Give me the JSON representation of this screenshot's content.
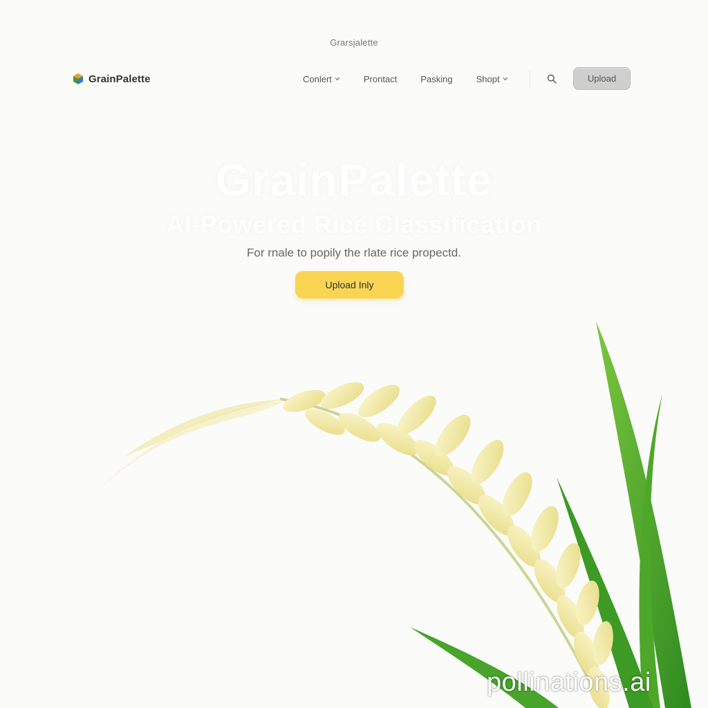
{
  "page": {
    "tagline": "Grarsįalette"
  },
  "header": {
    "brand": {
      "name": "GrainPalette",
      "logo_icon": "cube-logo-icon"
    },
    "nav": [
      {
        "label": "Conlert",
        "has_dropdown": true
      },
      {
        "label": "Prontact",
        "has_dropdown": false
      },
      {
        "label": "Pasking",
        "has_dropdown": false
      },
      {
        "label": "Shopt",
        "has_dropdown": true
      }
    ],
    "search_icon": "search-icon",
    "upload_label": "Upload"
  },
  "hero": {
    "title": "GrainPalette",
    "subtitle": "AI-Powered Rice Classification",
    "description": "For rnale to popily the rlate rice propectd.",
    "cta_label": "Upload Inly"
  },
  "illustration": {
    "subject": "rice-panicle-illustration"
  },
  "watermark": "pollinations.ai",
  "colors": {
    "background": "#fbfbfa",
    "cta": "#f9d553",
    "upload_button": "#cfcfcf",
    "grain": "#f1e9a0",
    "leaf": "#4da82a"
  }
}
